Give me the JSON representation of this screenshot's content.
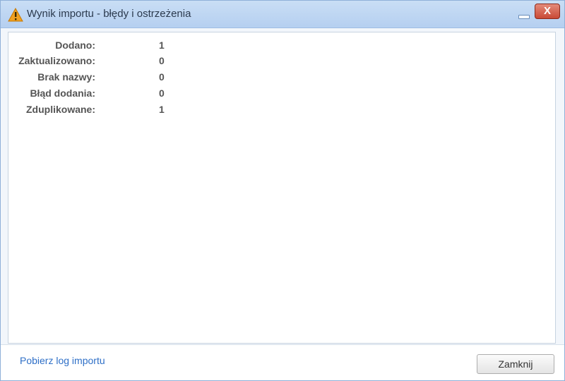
{
  "window": {
    "title": "Wynik importu - błędy i ostrzeżenia",
    "title_icon": "warning-icon",
    "close_glyph": "X"
  },
  "results": [
    {
      "label": "Dodano:",
      "value": "1"
    },
    {
      "label": "Zaktualizowano:",
      "value": "0"
    },
    {
      "label": "Brak nazwy:",
      "value": "0"
    },
    {
      "label": "Błąd dodania:",
      "value": "0"
    },
    {
      "label": "Zduplikowane:",
      "value": "1"
    }
  ],
  "footer": {
    "download_log_link": "Pobierz log importu",
    "close_button": "Zamknij"
  },
  "colors": {
    "titlebar": "#b5cff0",
    "link": "#2e6fc7",
    "close_button": "#c94a36"
  }
}
